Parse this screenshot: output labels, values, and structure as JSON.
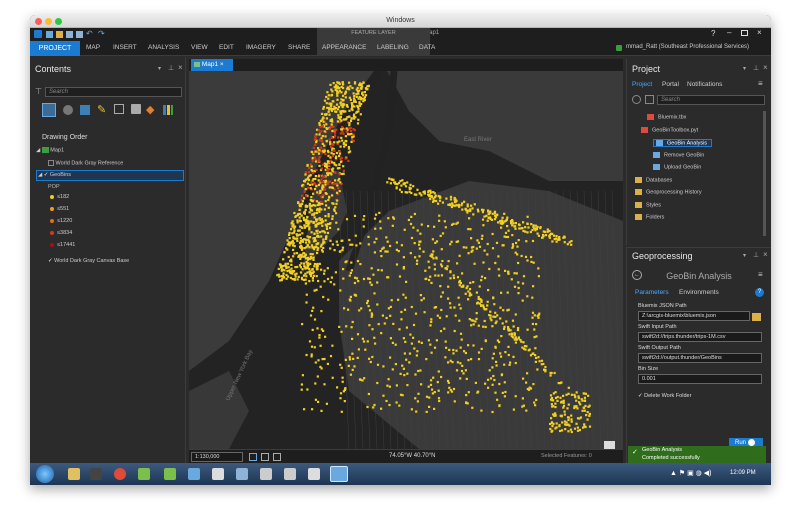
{
  "os": {
    "window_title": "Windows"
  },
  "app": {
    "title": "ArcGIS Pro - Bluemix - Map1",
    "help": "?",
    "contextual_tab_group": "FEATURE LAYER"
  },
  "ribbon": {
    "tabs": [
      "PROJECT",
      "MAP",
      "INSERT",
      "ANALYSIS",
      "VIEW",
      "EDIT",
      "IMAGERY",
      "SHARE",
      "APPEARANCE",
      "LABELING",
      "DATA"
    ],
    "user": "mmad_Ratt (Southeast Professional Services)"
  },
  "contents": {
    "title": "Contents",
    "search_placeholder": "Search",
    "drawing_order": "Drawing Order",
    "map_name": "Map1",
    "layers": [
      "World Dark Gray Reference",
      "GeoBins",
      "World Dark Gray Canvas Base"
    ],
    "legend_field": "POP",
    "legend_items": [
      {
        "label": "≤182",
        "color": "#f2d022"
      },
      {
        "label": "≤551",
        "color": "#f0a020"
      },
      {
        "label": "≤1220",
        "color": "#e86a1a"
      },
      {
        "label": "≤3834",
        "color": "#d33a1a"
      },
      {
        "label": "≤17441",
        "color": "#a81010"
      }
    ]
  },
  "map": {
    "tab": "Map1",
    "labels": {
      "east_river": "East River",
      "upper_bay": "Upper New York Bay",
      "brooklyn": "Brooklyn"
    },
    "scale": "1:130,000",
    "coords": "74.05°W 40.70°N",
    "selected": "Selected Features: 0"
  },
  "project": {
    "title": "Project",
    "tabs": [
      "Project",
      "Portal",
      "Notifications"
    ],
    "search_placeholder": "Search",
    "items": [
      "Bluemix.tbx",
      "GeoBinToolbox.pyt",
      "GeoBin Analysis",
      "Remove GeoBin",
      "Upload GeoBin",
      "Databases",
      "Geoprocessing History",
      "Styles",
      "Folders"
    ]
  },
  "geoprocessing": {
    "title": "Geoprocessing",
    "tool": "GeoBin Analysis",
    "tabs": [
      "Parameters",
      "Environments"
    ],
    "params": [
      {
        "label": "Bluemix JSON Path",
        "value": "Z:\\arcgis-bluemix\\bluemix.json"
      },
      {
        "label": "Swift Input Path",
        "value": "swift2d://trips.thunder/trips-1M.csv"
      },
      {
        "label": "Swift Output Path",
        "value": "swift2d://output.thunder/GeoBins"
      },
      {
        "label": "Bin Size",
        "value": "0.001"
      }
    ],
    "checkbox": "Delete Work Folder",
    "run": "Run",
    "status_title": "GeoBin Analysis",
    "status_msg": "Completed successfully"
  },
  "taskbar": {
    "time": "12:09 PM"
  },
  "colors": {
    "accent": "#1a7bd1",
    "bins": "#f2d022",
    "hot": "#d33a1a",
    "success": "#2f6d1c"
  }
}
